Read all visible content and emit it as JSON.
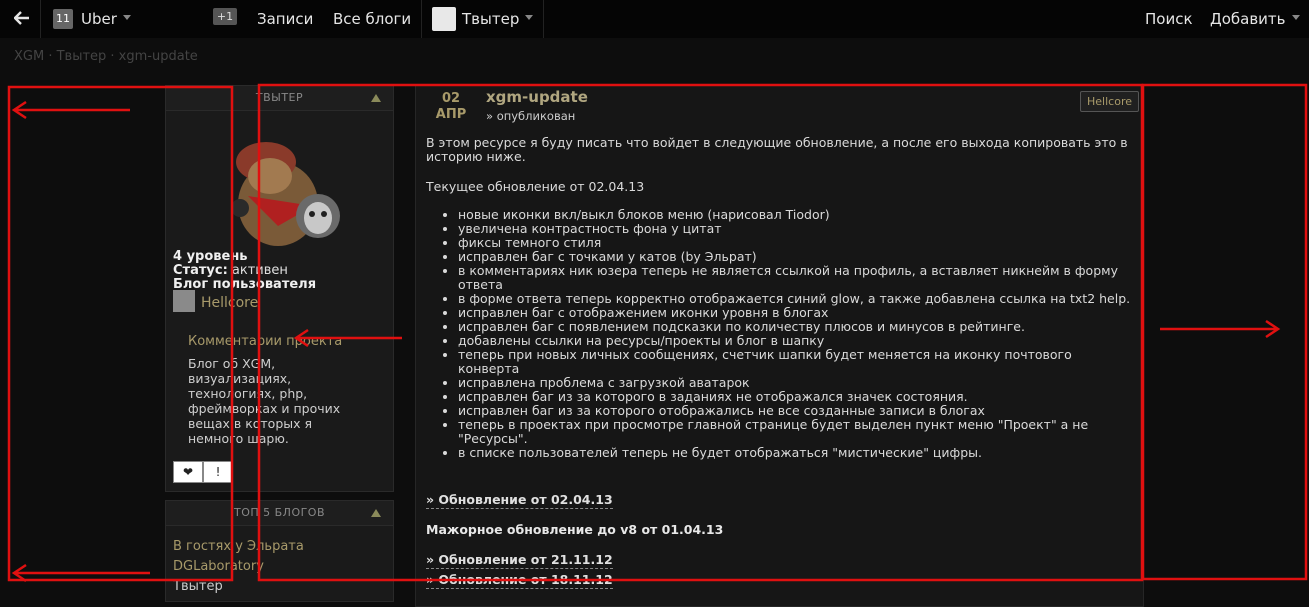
{
  "topbar": {
    "back_icon": "arrow-left-icon",
    "user_num": "11",
    "user_name": "Uber",
    "plus_badge": "+1",
    "nav_posts": "Записи",
    "nav_blogs": "Все блоги",
    "blog_name": "Твытер",
    "search": "Поиск",
    "add": "Добавить"
  },
  "breadcrumb": "XGM · Твытер · xgm-update",
  "sidebar": {
    "panel_title": "ТВЫТЕР",
    "level": "4 уровень",
    "status_label": "Статус:",
    "status_value": "активен",
    "blog_type": "Блог пользователя",
    "owner": "Hellcore",
    "desc_title": "Комментарии проекта",
    "desc": "Блог об XGM, визуализациях, технологиях, php, фреймворках и прочих вещах в которых я немного шарю.",
    "like_btn": "❤",
    "report_btn": "!",
    "top_title": "ТОП 5 БЛОГОВ",
    "top_blogs": [
      "В гостях у Эльрата",
      "DGLaboratory",
      "Твытер"
    ]
  },
  "post": {
    "day": "02",
    "month": "АПР",
    "title": "xgm-update",
    "status": "» опубликован",
    "author": "Hellcore",
    "intro": "В этом ресурсе я буду писать что войдет в следующие обновление, а после его выхода копировать это в историю ниже.",
    "current": "Текущее обновление от 02.04.13",
    "items": [
      "новые иконки вкл/выкл блоков меню (нарисовал Tiodor)",
      "увеличена контрастность фона у цитат",
      "фиксы темного стиля",
      "исправлен баг с точками у катов (by Эльрат)",
      "в комментариях ник юзера теперь не является ссылкой на профиль, а вставляет никнейм в форму ответа",
      "в форме ответа теперь корректно отображается синий glow, а также добавлена ссылка на txt2 help.",
      "исправлен баг с отображением иконки уровня в блогах",
      "исправлен баг с появлением подсказки по количеству плюсов и минусов в рейтинге.",
      "добавлены ссылки на ресурсы/проекты и блог в шапку",
      "теперь при новых личных сообщениях, счетчик шапки будет меняется на иконку почтового конверта",
      "исправлена проблема с загрузкой аватарок",
      "исправлен баг из за которого в заданиях не отображался значек состояния.",
      "исправлен баг из за которого отображались не все созданные записи в блогах",
      "теперь в проектах при просмотре главной странице будет выделен пункт меню \"Проект\" а не \"Ресурсы\".",
      "в списке пользователей теперь не будет отображаться \"мистические\" цифры."
    ],
    "upd1": "» Обновление от 02.04.13",
    "major": "Мажорное обновление до v8 от 01.04.13",
    "upd2": "» Обновление от 21.11.12",
    "upd3": "» Обновление от 18.11.12"
  },
  "colors": {
    "annotation": "#e01010",
    "accent": "#a89a6a"
  }
}
